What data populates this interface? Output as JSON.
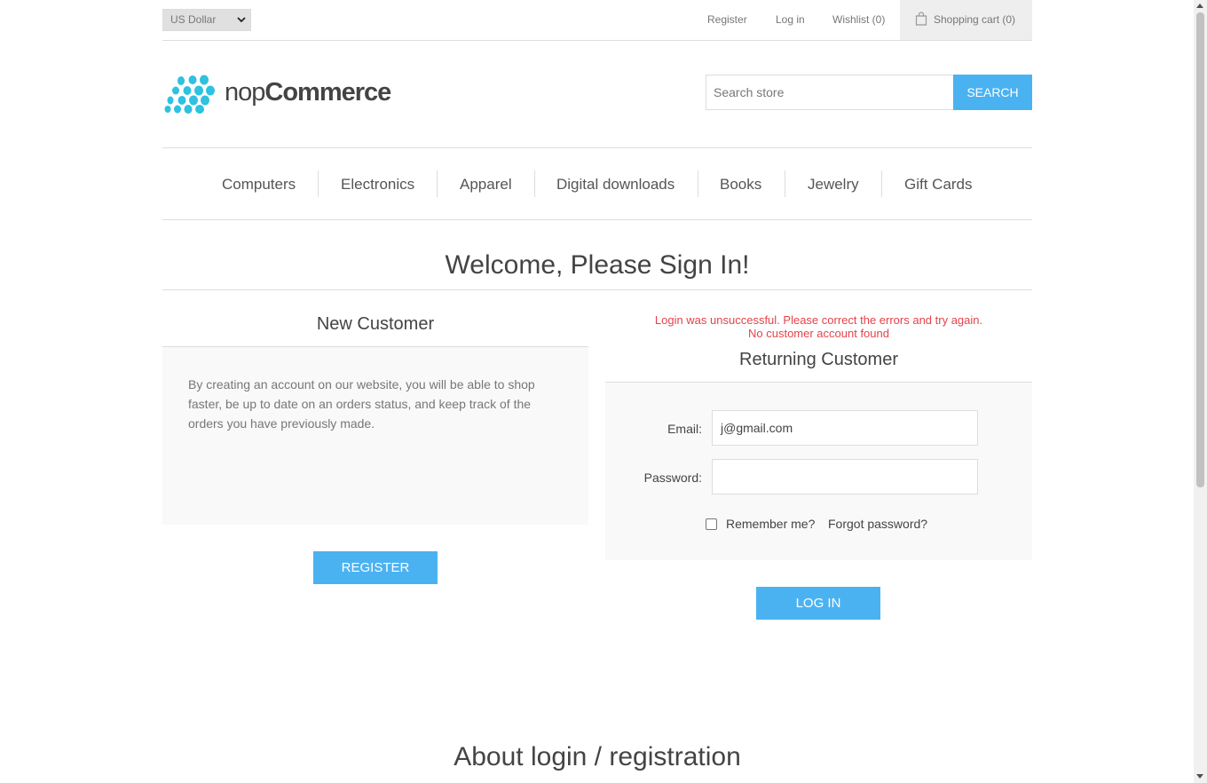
{
  "header": {
    "currency": "US Dollar",
    "links": {
      "register": "Register",
      "login": "Log in",
      "wishlist": "Wishlist (0)",
      "cart": "Shopping cart (0)"
    }
  },
  "logo": {
    "text_light": "nop",
    "text_bold": "Commerce"
  },
  "search": {
    "placeholder": "Search store",
    "button": "Search"
  },
  "menu": {
    "items": [
      "Computers",
      "Electronics",
      "Apparel",
      "Digital downloads",
      "Books",
      "Jewelry",
      "Gift Cards"
    ]
  },
  "page": {
    "title": "Welcome, Please Sign In!"
  },
  "new_customer": {
    "title": "New Customer",
    "text": "By creating an account on our website, you will be able to shop faster, be up to date on an orders status, and keep track of the orders you have previously made.",
    "button": "Register"
  },
  "returning_customer": {
    "errors": [
      "Login was unsuccessful. Please correct the errors and try again.",
      "No customer account found"
    ],
    "title": "Returning Customer",
    "email_label": "Email:",
    "email_value": "j@gmail.com",
    "password_label": "Password:",
    "password_value": "",
    "remember_label": "Remember me?",
    "remember_checked": false,
    "forgot_label": "Forgot password?",
    "button": "Log in"
  },
  "about": {
    "title": "About login / registration"
  },
  "colors": {
    "accent": "#4ab2f1",
    "error": "#e4434b",
    "logo": "#2ec1e0"
  }
}
